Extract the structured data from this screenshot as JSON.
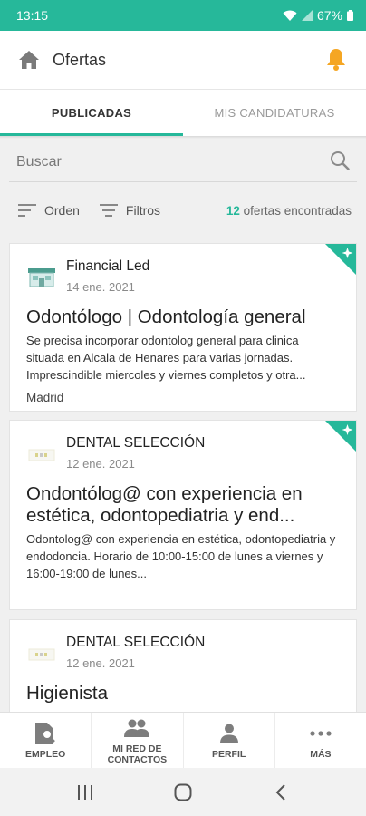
{
  "status_bar": {
    "time": "13:15",
    "battery": "67%"
  },
  "header": {
    "title": "Ofertas",
    "home_icon": "home-icon",
    "bell_icon": "bell-icon",
    "bell_color": "#f5a623"
  },
  "tabs": [
    {
      "label": "PUBLICADAS",
      "active": true
    },
    {
      "label": "MIS CANDIDATURAS",
      "active": false
    }
  ],
  "search": {
    "placeholder": "Buscar"
  },
  "filters": {
    "order_label": "Orden",
    "filter_label": "Filtros",
    "count": "12",
    "count_suffix": " ofertas encontradas"
  },
  "jobs": [
    {
      "company": "Financial Led",
      "date": "14 ene. 2021",
      "title": "Odontólogo | Odontología general",
      "description": "Se precisa incorporar odontolog general para clinica situada en Alcala de Henares para varias jornadas. Imprescindible miercoles y viernes completos y otra...",
      "location": "Madrid",
      "new_badge": true
    },
    {
      "company": "DENTAL SELECCIÓN",
      "date": "12 ene. 2021",
      "title": "Ondontólog@ con experiencia en estética, odontopediatria y end...",
      "description": "Odontolog@ con experiencia en estética, odontopediatria y endodoncia. Horario de 10:00-15:00 de lunes a viernes y 16:00-19:00 de lunes...",
      "new_badge": true
    },
    {
      "company": "DENTAL SELECCIÓN",
      "date": "12 ene. 2021",
      "title": "Higienista",
      "new_badge": false
    }
  ],
  "bottom_nav": [
    {
      "label": "EMPLEO",
      "icon": "jobs-icon"
    },
    {
      "label": "MI RED DE CONTACTOS",
      "icon": "contacts-icon"
    },
    {
      "label": "PERFIL",
      "icon": "profile-icon"
    },
    {
      "label": "MÁS",
      "icon": "more-icon"
    }
  ],
  "colors": {
    "accent": "#26b89a",
    "bell": "#f5a623"
  }
}
